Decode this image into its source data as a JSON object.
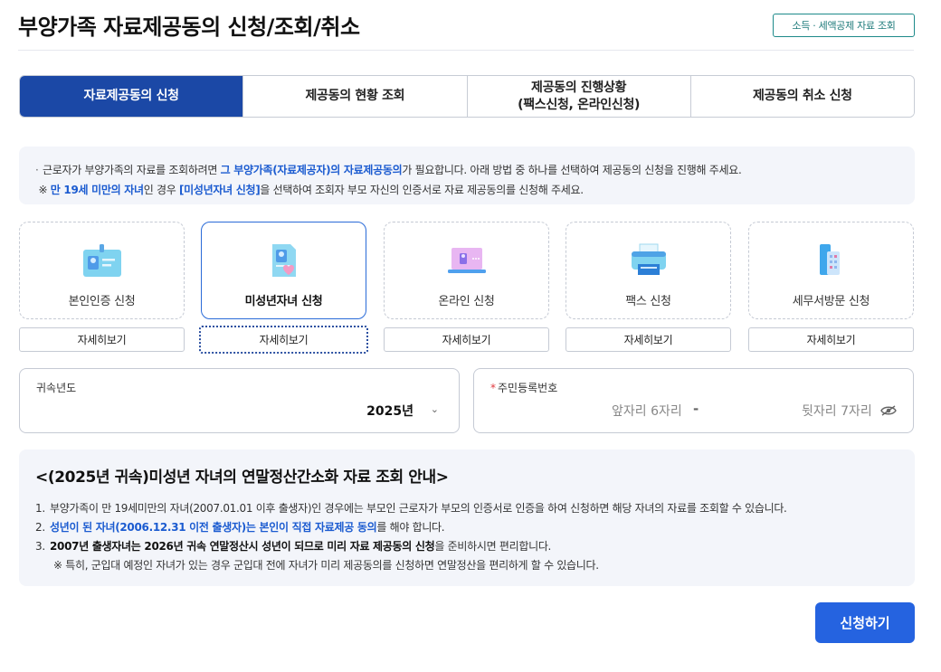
{
  "page": {
    "title": "부양가족 자료제공동의 신청/조회/취소",
    "top_link": "소득 · 세액공제 자료 조회"
  },
  "tabs": [
    {
      "label": "자료제공동의 신청",
      "label2": "",
      "active": true
    },
    {
      "label": "제공동의 현황 조회",
      "label2": "",
      "active": false
    },
    {
      "label": "제공동의 진행상황",
      "label2": "(팩스신청, 온라인신청)",
      "active": false
    },
    {
      "label": "제공동의 취소 신청",
      "label2": "",
      "active": false
    }
  ],
  "notice": {
    "line1_a": "근로자가 부양가족의 자료를 조회하려면 ",
    "line1_b": "그 부양가족(자료제공자)의 자료제공동의",
    "line1_c": "가 필요합니다. 아래 방법 중 하나를 선택하여 제공동의 신청을 진행해 주세요.",
    "line2_a": "※ ",
    "line2_b": "만 19세 미만의 자녀",
    "line2_c": "인 경우 ",
    "line2_d": "[미성년자녀 신청]",
    "line2_e": "을 선택하여 조회자 부모 자신의 인증서로 자료 제공동의를 신청해 주세요."
  },
  "methods": [
    {
      "label": "본인인증 신청",
      "icon": "id-card-icon",
      "detail": "자세히보기"
    },
    {
      "label": "미성년자녀 신청",
      "icon": "document-heart-icon",
      "detail": "자세히보기",
      "selected": true
    },
    {
      "label": "온라인 신청",
      "icon": "laptop-icon",
      "detail": "자세히보기"
    },
    {
      "label": "팩스 신청",
      "icon": "fax-icon",
      "detail": "자세히보기"
    },
    {
      "label": "세무서방문 신청",
      "icon": "building-icon",
      "detail": "자세히보기"
    }
  ],
  "form": {
    "year_label": "귀속년도",
    "year_value": "2025년",
    "rrn_label": "주민등록번호",
    "rrn_required_mark": "*",
    "rrn_front_placeholder": "앞자리 6자리",
    "rrn_separator": "-",
    "rrn_back_placeholder": "뒷자리 7자리"
  },
  "info": {
    "title": "<(2025년 귀속)미성년 자녀의 연말정산간소화 자료 조회 안내>",
    "item1_num": "1.",
    "item1": "부양가족이 만 19세미만의 자녀(2007.01.01 이후 출생자)인 경우에는 부모인 근로자가 부모의 인증서로 인증을 하여 신청하면 해당 자녀의 자료를 조회할 수 있습니다.",
    "item2_num": "2.",
    "item2_blue": "성년이 된 자녀(2006.12.31 이전 출생자)는 본인이 직접 자료제공 동의",
    "item2_rest": "를 해야 합니다.",
    "item3_num": "3.",
    "item3_bold": "2007년 출생자녀는 2026년 귀속 연말정산시 성년이 되므로 미리 자료 제공동의 신청",
    "item3_rest": "을 준비하시면 편리합니다.",
    "note": "※ 특히, 군입대 예정인 자녀가 있는 경우 군입대 전에 자녀가 미리 제공동의를 신청하면 연말정산을 편리하게 할 수 있습니다."
  },
  "submit_label": "신청하기",
  "colors": {
    "tab_active": "#1b48a6",
    "highlight_blue": "#1b5bd0",
    "submit": "#2563e0"
  }
}
